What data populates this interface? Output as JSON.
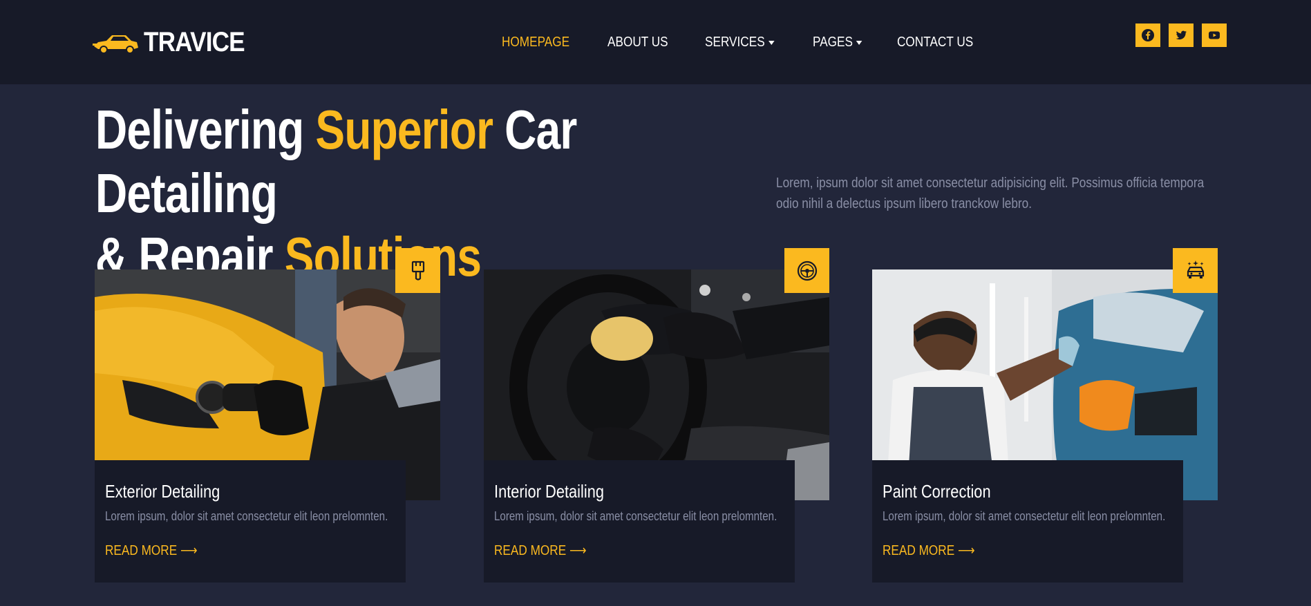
{
  "brand": {
    "name": "TRAVICE",
    "logo_icon": "car-icon"
  },
  "nav": {
    "items": [
      {
        "label": "HOMEPAGE",
        "active": true,
        "dropdown": false
      },
      {
        "label": "ABOUT US",
        "active": false,
        "dropdown": false
      },
      {
        "label": "SERVICES",
        "active": false,
        "dropdown": true
      },
      {
        "label": "PAGES",
        "active": false,
        "dropdown": true
      },
      {
        "label": "CONTACT US",
        "active": false,
        "dropdown": false
      }
    ]
  },
  "social": [
    "facebook-icon",
    "twitter-icon",
    "youtube-icon"
  ],
  "hero": {
    "line1_part1": "Delivering ",
    "line1_highlight": "Superior",
    "line1_part2": " Car Detailing",
    "line2_part1": "& Repair ",
    "line2_highlight": "Solutions",
    "description": "Lorem, ipsum dolor sit amet consectetur adipisicing elit. Possimus officia tempora odio nihil a delectus ipsum libero tranckow lebro."
  },
  "cards": [
    {
      "title": "Exterior Detailing",
      "text": "Lorem ipsum, dolor sit amet consectetur elit leon prelomnten.",
      "link": "READ MORE ⟶",
      "icon": "brush-icon"
    },
    {
      "title": "Interior Detailing",
      "text": "Lorem ipsum, dolor sit amet consectetur elit leon prelomnten.",
      "link": "READ MORE ⟶",
      "icon": "steering-wheel-icon"
    },
    {
      "title": "Paint Correction",
      "text": "Lorem ipsum, dolor sit amet consectetur elit leon prelomnten.",
      "link": "READ MORE ⟶",
      "icon": "car-sparkle-icon"
    }
  ],
  "colors": {
    "accent": "#fbb91f",
    "header_bg": "#171a28",
    "page_bg": "#22263a",
    "muted_text": "#8a8fa6"
  }
}
